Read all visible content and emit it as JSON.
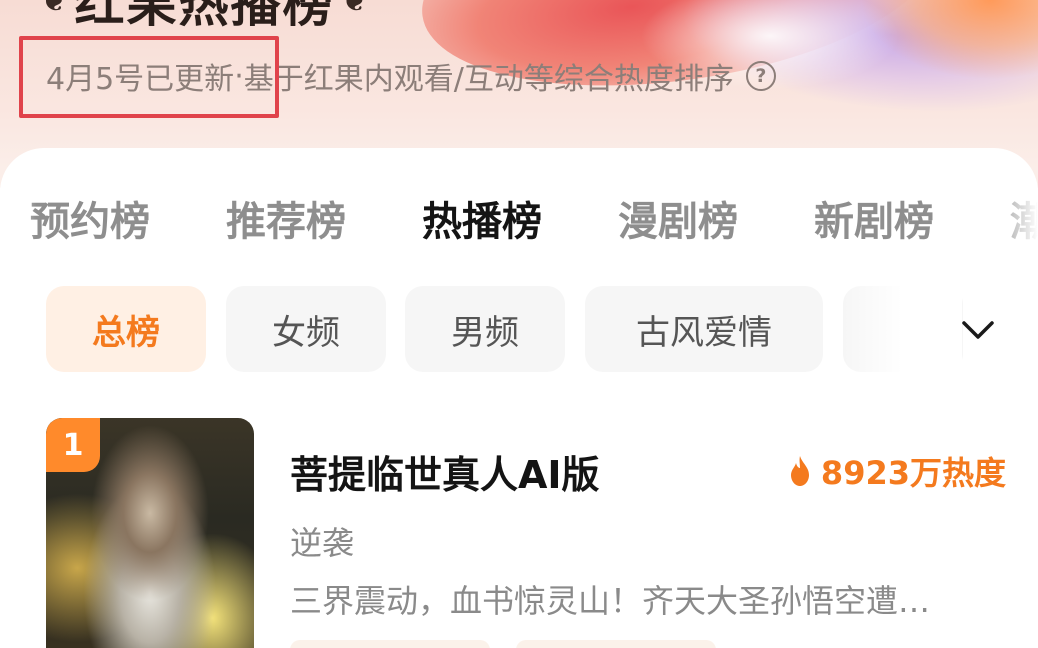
{
  "header": {
    "title": "红果热播榜",
    "update_text": "4月5号已更新",
    "separator": "·",
    "description": "基于红果内观看/互动等综合热度排序",
    "help_glyph": "?"
  },
  "tabs": [
    {
      "label": "预约榜",
      "active": false
    },
    {
      "label": "推荐榜",
      "active": false
    },
    {
      "label": "热播榜",
      "active": true
    },
    {
      "label": "漫剧榜",
      "active": false
    },
    {
      "label": "新剧榜",
      "active": false
    },
    {
      "label": "潮",
      "active": false
    }
  ],
  "chips": [
    {
      "label": "总榜",
      "active": true
    },
    {
      "label": "女频",
      "active": false
    },
    {
      "label": "男频",
      "active": false
    },
    {
      "label": "古风爱情",
      "active": false
    }
  ],
  "list": [
    {
      "rank": "1",
      "title": "菩提临世真人AI版",
      "heat": "8923万热度",
      "genre": "逆袭",
      "description": "三界震动，血书惊灵山！齐天大圣孙悟空遭…"
    }
  ],
  "colors": {
    "accent": "#f47a1e",
    "highlight_box": "#e0434b",
    "rank_badge": "#ff8a2b"
  }
}
